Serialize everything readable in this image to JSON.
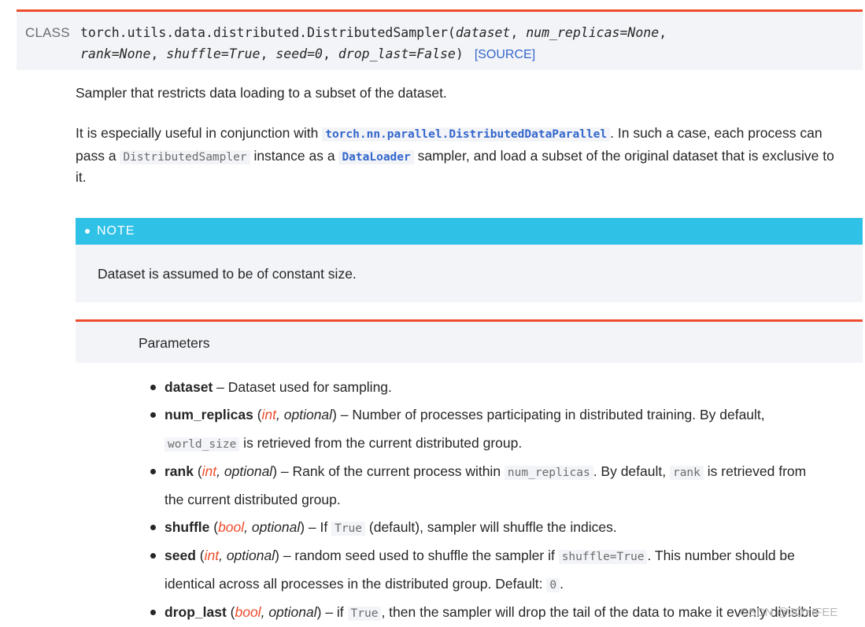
{
  "signature": {
    "kind": "CLASS",
    "qualname": "torch.utils.data.distributed.DistributedSampler",
    "open_paren": "(",
    "close_paren": ")",
    "params_line1": [
      {
        "text": "dataset",
        "sep": ", "
      },
      {
        "text": "num_replicas=None",
        "sep": ","
      }
    ],
    "params_line2": [
      {
        "text": "rank=None",
        "sep": ", "
      },
      {
        "text": "shuffle=True",
        "sep": ", "
      },
      {
        "text": "seed=0",
        "sep": ", "
      },
      {
        "text": "drop_last=False",
        "sep": ""
      }
    ],
    "source_link": "[SOURCE]"
  },
  "description": {
    "para1": "Sampler that restricts data loading to a subset of the dataset.",
    "para2": {
      "l1_a": "It is especially useful in conjunction with ",
      "l1_code": "torch.nn.parallel.DistributedDataParallel",
      "l1_b": ". In such a case, each process can",
      "l2_a": "pass a ",
      "l2_code1": "DistributedSampler",
      "l2_b": " instance as a ",
      "l2_code2": "DataLoader",
      "l2_c": " sampler, and load a subset of the original dataset that is exclusive to",
      "l3": "it."
    }
  },
  "note": {
    "title": "NOTE",
    "body": "Dataset is assumed to be of constant size."
  },
  "parameters": {
    "title": "Parameters",
    "items": {
      "dataset": {
        "name": "dataset",
        "desc": " – Dataset used for sampling."
      },
      "num_replicas": {
        "name": "num_replicas",
        "open": " (",
        "type": "int",
        "comma": ",",
        "opt": " optional",
        "close": ")",
        "desc1": " – Number of processes participating in distributed training. By default,",
        "code1": "world_size",
        "desc2": " is retrieved from the current distributed group."
      },
      "rank": {
        "name": "rank",
        "open": " (",
        "type": "int",
        "comma": ",",
        "opt": " optional",
        "close": ")",
        "desc1": " – Rank of the current process within ",
        "code1": "num_replicas",
        "desc1b": ". By default, ",
        "code2": "rank",
        "desc1c": " is retrieved from",
        "desc2": "the current distributed group."
      },
      "shuffle": {
        "name": "shuffle",
        "open": " (",
        "type": "bool",
        "comma": ",",
        "opt": " optional",
        "close": ")",
        "desc1": " – If ",
        "code1": "True",
        "desc1b": " (default), sampler will shuffle the indices."
      },
      "seed": {
        "name": "seed",
        "open": " (",
        "type": "int",
        "comma": ",",
        "opt": " optional",
        "close": ")",
        "desc1": " – random seed used to shuffle the sampler if ",
        "code1": "shuffle=True",
        "desc1b": ". This number should be",
        "desc2": "identical across all processes in the distributed group. Default: ",
        "code2": "0",
        "desc2b": "."
      },
      "drop_last": {
        "name": "drop_last",
        "open": " (",
        "type": "bool",
        "comma": ",",
        "opt": " optional",
        "close": ")",
        "desc1": " – if ",
        "code1": "True",
        "desc1b": ", then the sampler will drop the tail of the data to make it evenly divisible"
      }
    }
  },
  "watermark": "CSDN @JOYIFEE",
  "colors": {
    "accent": "#ee4c2c",
    "note_header": "#2fc1e6",
    "link": "#3366cc",
    "panel_bg": "#f3f4f7"
  }
}
